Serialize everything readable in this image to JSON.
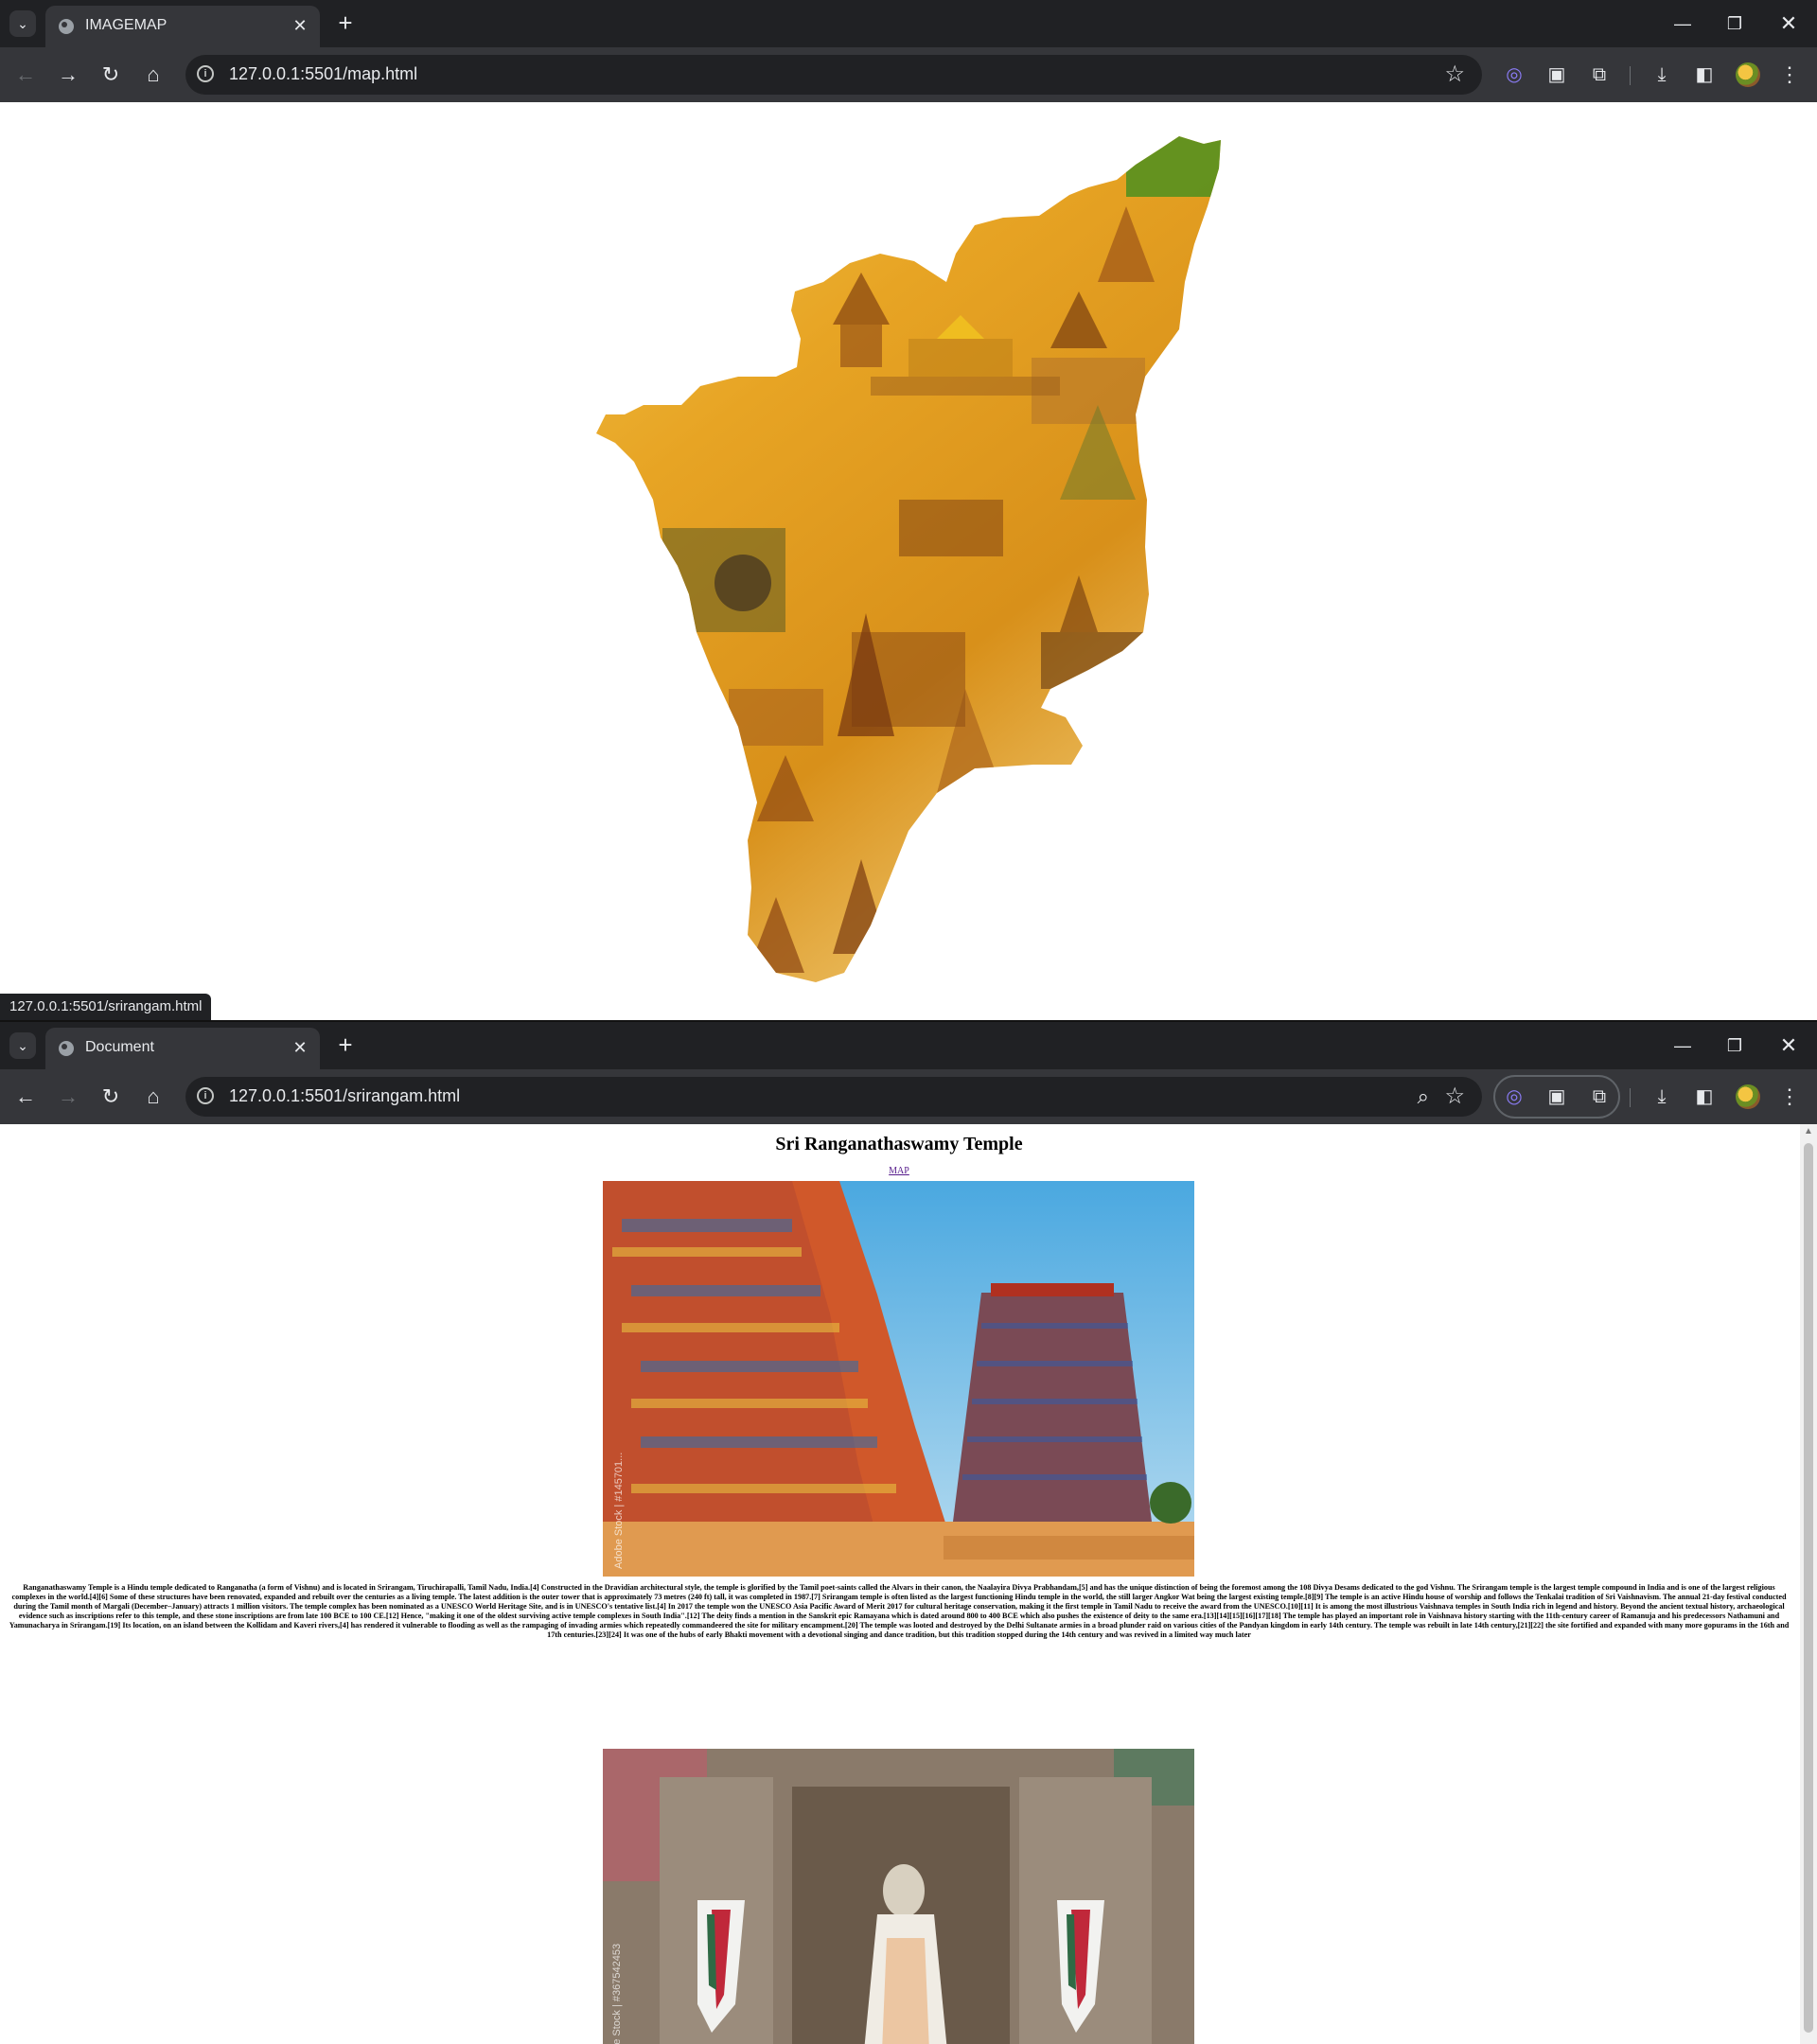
{
  "window1": {
    "tab_menu_icon": "chevron-down-icon",
    "tab_title": "IMAGEMAP",
    "url": "127.0.0.1:5501/map.html",
    "status_url": "127.0.0.1:5501/srirangam.html"
  },
  "window2": {
    "tab_menu_icon": "chevron-down-icon",
    "tab_title": "Document",
    "url": "127.0.0.1:5501/srirangam.html"
  },
  "page": {
    "heading": "Sri Ranganathaswamy Temple",
    "map_link": "MAP",
    "photo1_watermark": "Adobe Stock | #145701...",
    "photo2_watermark": "obe Stock | #367542453",
    "body": "Ranganathaswamy Temple is a Hindu temple dedicated to Ranganatha (a form of Vishnu) and is located in Srirangam, Tiruchirapalli, Tamil Nadu, India.[4] Constructed in the Dravidian architectural style, the temple is glorified by the Tamil poet-saints called the Alvars in their canon, the Naalayira Divya Prabhandam,[5] and has the unique distinction of being the foremost among the 108 Divya Desams dedicated to the god Vishnu. The Srirangam temple is the largest temple compound in India and is one of the largest religious complexes in the world.[4][6] Some of these structures have been renovated, expanded and rebuilt over the centuries as a living temple. The latest addition is the outer tower that is approximately 73 metres (240 ft) tall, it was completed in 1987.[7] Srirangam temple is often listed as the largest functioning Hindu temple in the world, the still larger Angkor Wat being the largest existing temple.[8][9] The temple is an active Hindu house of worship and follows the Tenkalai tradition of Sri Vaishnavism. The annual 21-day festival conducted during the Tamil month of Margali (December–January) attracts 1 million visitors. The temple complex has been nominated as a UNESCO World Heritage Site, and is in UNESCO's tentative list.[4] In 2017 the temple won the UNESCO Asia Pacific Award of Merit 2017 for cultural heritage conservation, making it the first temple in Tamil Nadu to receive the award from the UNESCO.[10][11] It is among the most illustrious Vaishnava temples in South India rich in legend and history. Beyond the ancient textual history, archaeological evidence such as inscriptions refer to this temple, and these stone inscriptions are from late 100 BCE to 100 CE.[12] Hence, \"making it one of the oldest surviving active temple complexes in South India\".[12] The deity finds a mention in the Sanskrit epic Ramayana which is dated around 800 to 400 BCE which also pushes the existence of deity to the same era.[13][14][15][16][17][18] The temple has played an important role in Vaishnava history starting with the 11th-century career of Ramanuja and his predecessors Nathamuni and Yamunacharya in Srirangam.[19] Its location, on an island between the Kollidam and Kaveri rivers,[4] has rendered it vulnerable to flooding as well as the rampaging of invading armies which repeatedly commandeered the site for military encampment.[20] The temple was looted and destroyed by the Delhi Sultanate armies in a broad plunder raid on various cities of the Pandyan kingdom in early 14th century. The temple was rebuilt in late 14th century,[21][22] the site fortified and expanded with many more gopurams in the 16th and 17th centuries.[23][24] It was one of the hubs of early Bhakti movement with a devotional singing and dance tradition, but this tradition stopped during the 14th century and was revived in a limited way much later"
  },
  "icons": {
    "back": "arrow-left-icon",
    "forward": "arrow-right-icon",
    "reload": "reload-icon",
    "home": "home-icon",
    "info": "info-icon",
    "star": "star-icon",
    "zoom": "zoom-icon",
    "download": "download-icon",
    "menu": "kebab-menu-icon"
  },
  "colors": {
    "chrome_dark": "#202124",
    "chrome_toolbar": "#35363a",
    "map_gold": "#e0a020",
    "link_visited": "#551a8b"
  }
}
